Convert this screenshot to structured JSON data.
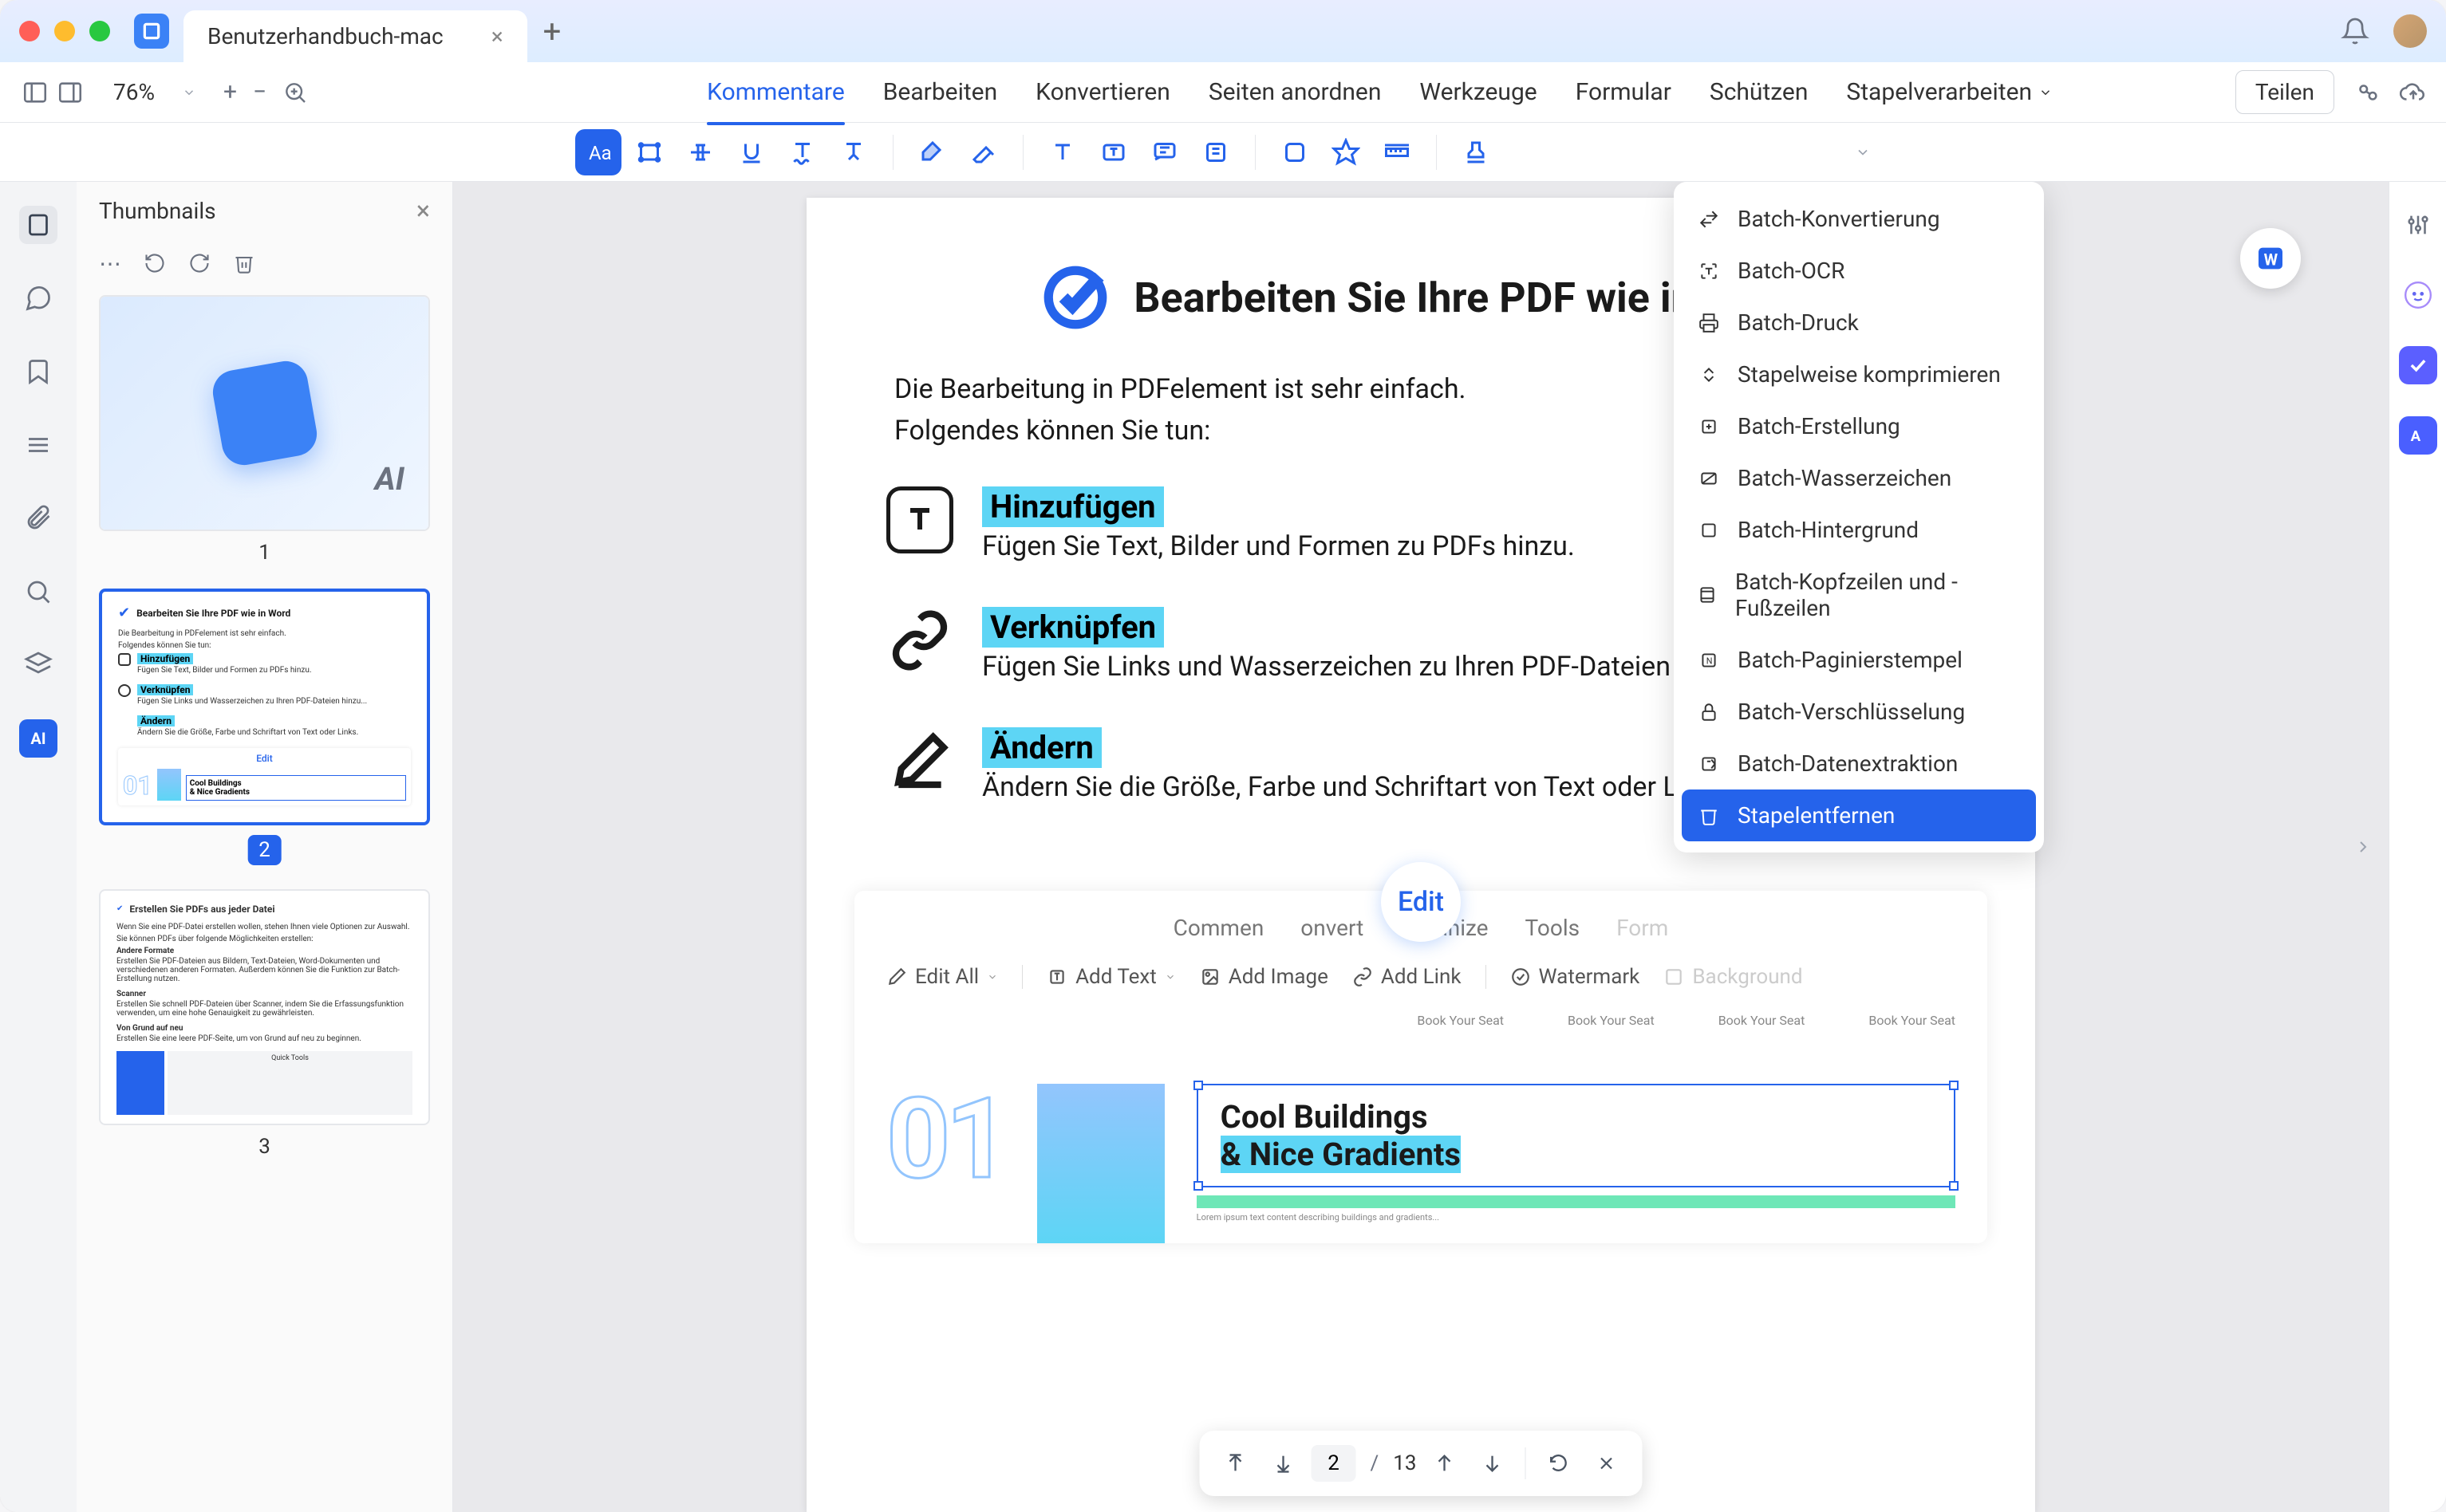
{
  "titlebar": {
    "tab_title": "Benutzerhandbuch-mac"
  },
  "menubar": {
    "zoom": "76%",
    "items": [
      "Kommentare",
      "Bearbeiten",
      "Konvertieren",
      "Seiten anordnen",
      "Werkzeuge",
      "Formular",
      "Schützen",
      "Stapelverarbeiten"
    ],
    "share": "Teilen"
  },
  "thumbnails": {
    "title": "Thumbnails",
    "pages": [
      "1",
      "2",
      "3"
    ],
    "selected": 2,
    "page1_ai": "AI",
    "page2": {
      "title": "Bearbeiten Sie Ihre PDF wie in Word",
      "intro": "Die Bearbeitung in PDFelement ist sehr einfach.",
      "intro2": "Folgendes können Sie tun:",
      "f1_title": "Hinzufügen",
      "f1_desc": "Fügen Sie Text, Bilder und Formen zu PDFs hinzu.",
      "f2_title": "Verknüpfen",
      "f2_desc": "Fügen Sie Links und Wasserzeichen zu Ihren PDF-Dateien hinzu...",
      "f3_title": "Ändern",
      "f3_desc": "Ändern Sie die Größe, Farbe und Schriftart von Text oder Links.",
      "edit_label": "Edit",
      "mock_title": "Cool Buildings",
      "mock_sub": "& Nice Gradients"
    },
    "page3": {
      "title": "Erstellen Sie PDFs aus jeder Datei",
      "intro": "Wenn Sie eine PDF-Datei erstellen wollen, stehen Ihnen viele Optionen zur Auswahl.",
      "line2": "Sie können PDFs über folgende Möglichkeiten erstellen:",
      "s1_title": "Andere Formate",
      "s1_desc": "Erstellen Sie PDF-Dateien aus Bildern, Text-Dateien, Word-Dokumenten und verschiedenen anderen Formaten. Außerdem können Sie die Funktion zur Batch-Erstellung nutzen.",
      "s2_title": "Scanner",
      "s2_desc": "Erstellen Sie schnell PDF-Dateien über Scanner, indem Sie die Erfassungsfunktion verwenden, um eine hohe Genauigkeit zu gewährleisten.",
      "s3_title": "Von Grund auf neu",
      "s3_desc": "Erstellen Sie eine leere PDF-Seite, um von Grund auf neu zu beginnen.",
      "quick_tools": "Quick Tools"
    }
  },
  "dropdown": {
    "items": [
      "Batch-Konvertierung",
      "Batch-OCR",
      "Batch-Druck",
      "Stapelweise komprimieren",
      "Batch-Erstellung",
      "Batch-Wasserzeichen",
      "Batch-Hintergrund",
      "Batch-Kopfzeilen und -Fußzeilen",
      "Batch-Paginierstempel",
      "Batch-Verschlüsselung",
      "Batch-Datenextraktion",
      "Stapelentfernen"
    ],
    "highlighted_index": 11
  },
  "page": {
    "title": "Bearbeiten Sie Ihre PDF wie in Word",
    "intro1": "Die Bearbeitung in PDFelement ist sehr einfach.",
    "intro2": "Folgendes können Sie tun:",
    "features": [
      {
        "title": "Hinzufügen",
        "desc": "Fügen Sie Text, Bilder und Formen zu PDFs hinzu."
      },
      {
        "title": "Verknüpfen",
        "desc": "Fügen Sie Links und Wasserzeichen zu Ihren PDF-Dateien hinzu."
      },
      {
        "title": "Ändern",
        "desc": "Ändern Sie die Größe, Farbe und Schriftart von Text oder Links."
      }
    ],
    "embedded": {
      "edit_bubble": "Edit",
      "tabs": [
        "Commen",
        "onvert",
        "Organize",
        "Tools",
        "Form"
      ],
      "tools": [
        "Edit All",
        "Add Text",
        "Add Image",
        "Add Link",
        "Watermark",
        "Background"
      ],
      "book_seat": "Book Your Seat",
      "card_title": "Cool Buildings",
      "card_sub": "& Nice Gradients",
      "num01": "01"
    }
  },
  "bottom_nav": {
    "current": "2",
    "total": "13"
  },
  "left_rail_ai": "AI"
}
